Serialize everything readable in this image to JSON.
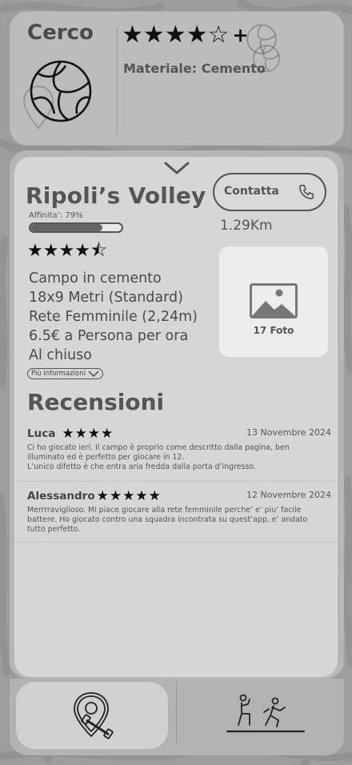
{
  "search": {
    "title": "Cerco",
    "rating_filter": {
      "full_stars": 4,
      "empty_stars": 1,
      "plus": "+"
    },
    "material": "Materiale: Cemento"
  },
  "venue": {
    "name": "Ripoli’s Volley",
    "affinity_label": "Affinita’: 79%",
    "affinity_value": 79,
    "rating": 4.5,
    "details": [
      "Campo in cemento",
      "18x9 Metri (Standard)",
      "Rete Femminile (2,24m)",
      "6.5€ a Persona per ora",
      "Al chiuso"
    ],
    "more_info": "Più informazioni",
    "contact_label": "Contatta",
    "distance": "1.29Km",
    "photo_count": "17 Foto"
  },
  "reviews": {
    "title": "Recensioni",
    "items": [
      {
        "author": "Luca",
        "stars": 4,
        "date": "13 Novembre 2024",
        "lines": [
          "Ci ho giocato ieri. Il campo è proprio come descritto dalla pagina, ben illuminato ed è perfetto per giocare in 12.",
          "L’unico difetto è che entra aria fredda dalla porta d’ingresso."
        ]
      },
      {
        "author": "Alessandro",
        "stars": 5,
        "date": "12 Novembre 2024",
        "lines": [
          "Merrrraviglioso. Mi piace giocare alla rete femminile perche’ e’ piu’ facile battere. Ho giocato contro una squadra incontrata su quest’app, e’ andato tutto perfetto."
        ]
      }
    ]
  },
  "nav": {
    "items": [
      {
        "icon": "map-pin-dumbbell-icon",
        "active": true
      },
      {
        "icon": "sport-players-icon",
        "active": false
      }
    ]
  },
  "colors": {
    "background": "#9d9d9d",
    "card": "#bcbcbc",
    "panel": "#d6d6d6",
    "text": "#555555",
    "stars": "#111111"
  }
}
